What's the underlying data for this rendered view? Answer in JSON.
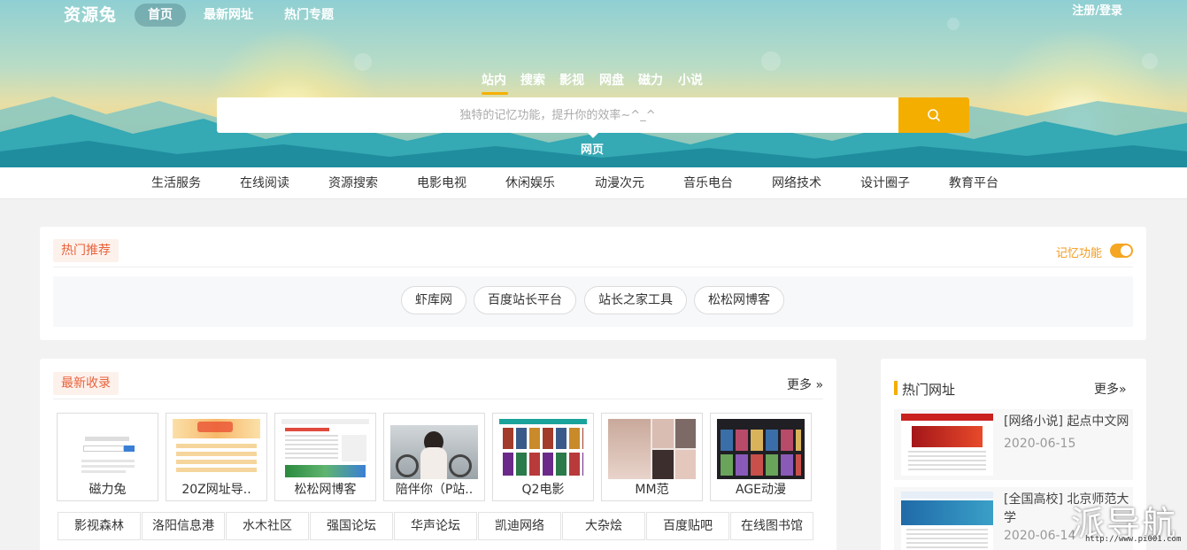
{
  "topnav": {
    "logo": "资源兔",
    "items": [
      "首页",
      "最新网址",
      "热门专题"
    ],
    "login": "注册/登录"
  },
  "search": {
    "tabs": [
      "站内",
      "搜索",
      "影视",
      "网盘",
      "磁力",
      "小说"
    ],
    "active_tab": "站内",
    "placeholder": "独特的记忆功能，提升你的效率~^_^",
    "sub_label": "网页",
    "accent_color": "#f4ae00"
  },
  "categories": [
    "生活服务",
    "在线阅读",
    "资源搜索",
    "电影电视",
    "休闲娱乐",
    "动漫次元",
    "音乐电台",
    "网络技术",
    "设计圈子",
    "教育平台"
  ],
  "hot_recommend": {
    "title": "热门推荐",
    "memory_label": "记忆功能",
    "memory_on": true,
    "pills": [
      "虾库网",
      "百度站长平台",
      "站长之家工具",
      "松松网博客"
    ]
  },
  "latest": {
    "title": "最新收录",
    "more": "更多 »",
    "cards": [
      "磁力兔",
      "20Z网址导..",
      "松松网博客",
      "陪伴你（P站..",
      "Q2电影",
      "MM范",
      "AGE动漫"
    ],
    "links": [
      "影视森林",
      "洛阳信息港",
      "水木社区",
      "强国论坛",
      "华声论坛",
      "凯迪网络",
      "大杂烩",
      "百度贴吧",
      "在线图书馆"
    ]
  },
  "hot_sites": {
    "title": "热门网址",
    "more": "更多»",
    "items": [
      {
        "title": "[网络小说] 起点中文网",
        "date": "2020-06-15"
      },
      {
        "title": "[全国高校] 北京师范大学",
        "date": "2020-06-14"
      }
    ]
  },
  "watermark": {
    "text": "派导航",
    "url": "http://www.pi001.com"
  }
}
